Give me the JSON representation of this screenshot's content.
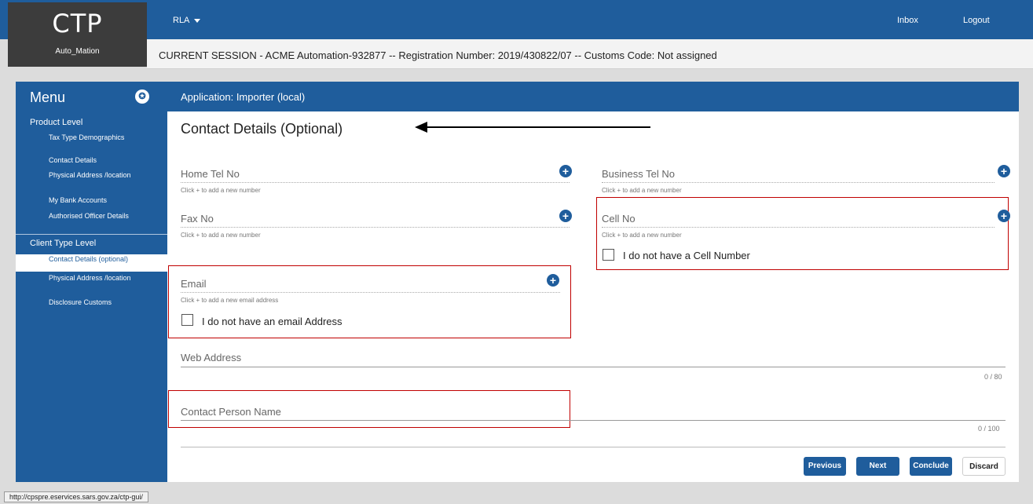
{
  "app": {
    "logo_title": "CTP",
    "logo_subtitle": "Auto_Mation"
  },
  "topnav": {
    "rla_label": "RLA",
    "inbox_label": "Inbox",
    "logout_label": "Logout"
  },
  "session": {
    "text": "CURRENT SESSION - ACME Automation-932877 -- Registration Number: 2019/430822/07 -- Customs Code: Not assigned"
  },
  "menu": {
    "title": "Menu",
    "sections": [
      {
        "label": "Product Level"
      },
      {
        "label": "Client Type Level"
      }
    ],
    "items": [
      {
        "label": "Tax Type Demographics"
      },
      {
        "label": "Contact Details"
      },
      {
        "label": "Physical Address /location"
      },
      {
        "label": "My Bank Accounts"
      },
      {
        "label": "Authorised Officer Details"
      },
      {
        "label": "Contact Details (optional)"
      },
      {
        "label": "Physical Address /location"
      },
      {
        "label": "Disclosure Customs"
      }
    ]
  },
  "application": {
    "title": "Application: Importer (local)"
  },
  "page": {
    "title": "Contact Details (Optional)"
  },
  "fields": {
    "home_tel": {
      "label": "Home Tel No",
      "hint": "Click + to add a new number"
    },
    "business_tel": {
      "label": "Business Tel No",
      "hint": "Click + to add a new number"
    },
    "fax": {
      "label": "Fax No",
      "hint": "Click + to add a new number"
    },
    "cell": {
      "label": "Cell No",
      "hint": "Click + to add a new number",
      "checkbox_label": "I do not have a Cell Number"
    },
    "email": {
      "label": "Email",
      "hint": "Click + to add a new email address",
      "checkbox_label": "I do not have an email Address"
    },
    "web": {
      "label": "Web Address",
      "counter": "0 / 80"
    },
    "contact_person": {
      "label": "Contact Person Name",
      "counter": "0 / 100"
    }
  },
  "buttons": {
    "previous": "Previous",
    "next": "Next",
    "conclude": "Conclude",
    "discard": "Discard"
  },
  "status_url": "http://cpspre.eservices.sars.gov.za/ctp-gui/",
  "colors": {
    "brand": "#1f5d9c",
    "highlight": "#c00000"
  }
}
